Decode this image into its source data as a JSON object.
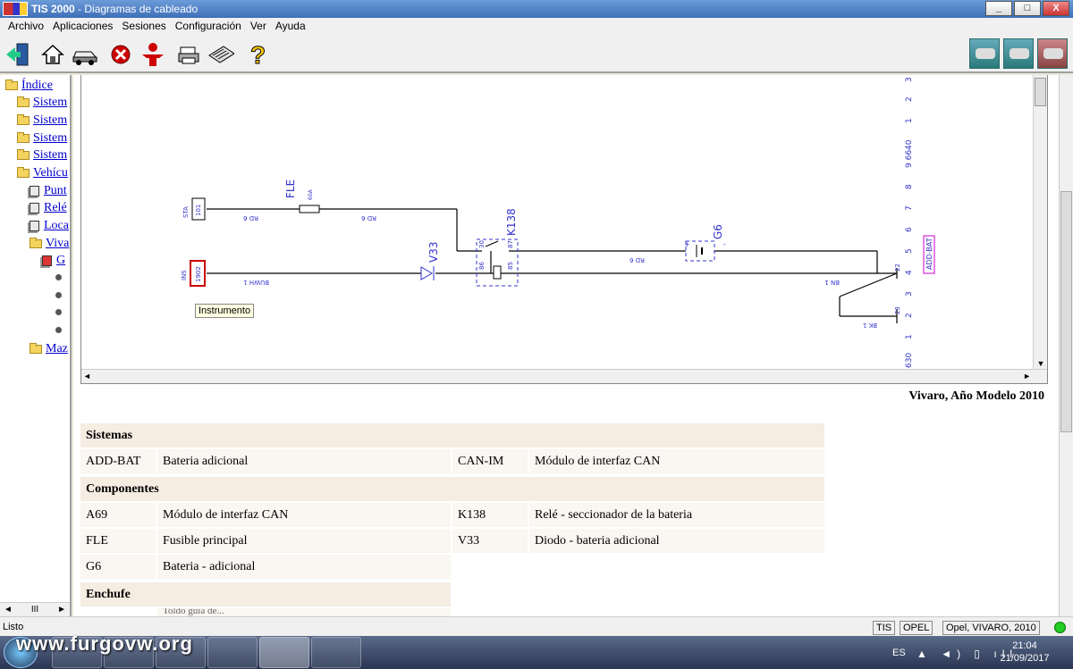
{
  "window": {
    "app_name": "TIS 2000",
    "title_suffix": " - Diagramas de cableado",
    "minimize": "_",
    "maximize": "□",
    "close": "X"
  },
  "menu": [
    "Archivo",
    "Aplicaciones",
    "Sesiones",
    "Configuración",
    "Ver",
    "Ayuda"
  ],
  "toolbar": {
    "left_icons": [
      "exit-icon",
      "home-icon",
      "car-icon",
      "stop-icon",
      "person-icon",
      "printer-icon",
      "notepad-icon",
      "help-icon"
    ],
    "right_icons": [
      "vehicle-diag-icon",
      "vehicle-tech-icon",
      "vehicle-comm-icon"
    ]
  },
  "sidebar": {
    "items": [
      {
        "label": "Índice",
        "icon": "folder-icon"
      },
      {
        "label": "Sistem",
        "icon": "folder-icon"
      },
      {
        "label": "Sistem",
        "icon": "folder-icon"
      },
      {
        "label": "Sistem",
        "icon": "folder-icon"
      },
      {
        "label": "Sistem",
        "icon": "folder-icon"
      },
      {
        "label": "Vehícu",
        "icon": "folder-open-icon"
      },
      {
        "label": "Punt",
        "icon": "document-icon"
      },
      {
        "label": "Relé",
        "icon": "document-icon"
      },
      {
        "label": "Loca",
        "icon": "document-icon"
      },
      {
        "label": "Viva",
        "icon": "folder-open-icon"
      },
      {
        "label": "G",
        "icon": "document-red-icon"
      },
      {
        "label": "Maz",
        "icon": "folder-icon"
      }
    ],
    "scroll_left": "◄",
    "scroll_right": "►",
    "scroll_mid": "III"
  },
  "diagram": {
    "comp_sta": "STA",
    "conn_101": "101",
    "comp_ins": "INS",
    "conn_1902": "1902",
    "fuse_label": "FLE",
    "fuse_value": "60A",
    "wire_rd6_a": "RD 6",
    "wire_rd6_b": "RD 6",
    "wire_rd6_c": "RD 6",
    "wire_buwh": "BUWH 1",
    "wire_bn1": "BN 1",
    "wire_bk1": "BK 1",
    "diode_label": "V33",
    "relay_label": "K138",
    "relay_pin30": "30",
    "relay_pin87": "87",
    "relay_pin86": "86",
    "relay_pin85": "85",
    "battery_label": "G6",
    "battery_plus": "+",
    "battery_minus": "-",
    "pin22": "22",
    "pin23": "23",
    "add_bat": "ADD-BAT",
    "ruler": [
      "3",
      "2",
      "1",
      "9 6640",
      "8",
      "7",
      "6",
      "5",
      "4",
      "3",
      "2",
      "1",
      "630"
    ],
    "tooltip": "Instrumento",
    "scroll_up": "▲",
    "scroll_down": "▼",
    "scroll_left": "◄",
    "scroll_right": "►"
  },
  "caption": "Vivaro, Año Modelo 2010",
  "legend": {
    "sistemas_title": "Sistemas",
    "sistemas": [
      {
        "code": "ADD-BAT",
        "desc": "Bateria adicional"
      },
      {
        "code": "CAN-IM",
        "desc": "Módulo de interfaz CAN"
      }
    ],
    "componentes_title": "Componentes",
    "componentes": [
      {
        "code": "A69",
        "desc": "Módulo de interfaz CAN"
      },
      {
        "code": "K138",
        "desc": "Relé - seccionador de la bateria"
      },
      {
        "code": "FLE",
        "desc": "Fusible principal"
      },
      {
        "code": "V33",
        "desc": "Diodo - bateria adicional"
      },
      {
        "code": "G6",
        "desc": "Bateria - adicional"
      }
    ],
    "enchufe_title": "Enchufe",
    "enchufe_partial": "Toldo guía de..."
  },
  "statusbar": {
    "status": "Listo",
    "tis": "TIS",
    "brand": "OPEL",
    "vehicle": "Opel, VIVARO, 2010"
  },
  "taskbar": {
    "watermark": "www.furgovw.org",
    "lang": "ES",
    "time": "21:04",
    "date": "21/09/2017"
  }
}
